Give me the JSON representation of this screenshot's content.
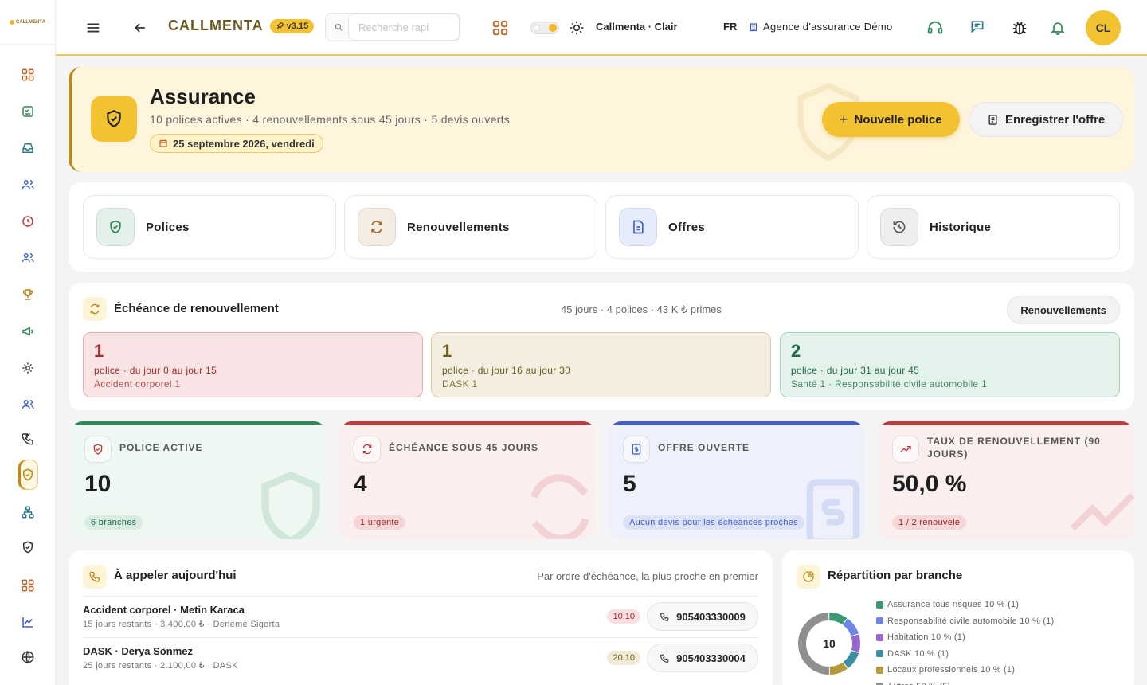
{
  "sidebar": {
    "logo": "CALLMENTA",
    "items": [
      {
        "icon": "dashboard-grid-icon"
      },
      {
        "icon": "checklist-icon"
      },
      {
        "icon": "inbox-icon"
      },
      {
        "icon": "users-icon"
      },
      {
        "icon": "clock-icon"
      },
      {
        "icon": "team-icon"
      },
      {
        "icon": "trophy-icon"
      },
      {
        "icon": "megaphone-icon"
      },
      {
        "icon": "gear-cycle-icon"
      },
      {
        "icon": "contacts-icon"
      },
      {
        "icon": "incoming-call-icon"
      },
      {
        "icon": "shield-icon",
        "active": true
      },
      {
        "icon": "org-chart-icon"
      },
      {
        "icon": "shield-check-icon"
      },
      {
        "icon": "apps-grid-icon"
      },
      {
        "icon": "line-chart-icon"
      },
      {
        "icon": "globe-icon"
      }
    ]
  },
  "topbar": {
    "brand": "CALLMENTA",
    "version": "v3.15",
    "search_placeholder": "Recherche rapi",
    "theme_label": "Callmenta · Clair",
    "language": "FR",
    "agency": "Agence d'assurance Démo",
    "avatar": "CL"
  },
  "hero": {
    "title": "Assurance",
    "subtitle": "10 polices actives · 4 renouvellements sous 45 jours · 5 devis ouverts",
    "date": "25 septembre 2026, vendredi",
    "primary_button": "Nouvelle police",
    "secondary_button": "Enregistrer l'offre"
  },
  "tiles": [
    {
      "label": "Polices",
      "icon": "shield-check-icon",
      "color": "#e3f1ea"
    },
    {
      "label": "Renouvellements",
      "icon": "refresh-icon",
      "color": "#f4ece2"
    },
    {
      "label": "Offres",
      "icon": "document-icon",
      "color": "#e6ecfb"
    },
    {
      "label": "Historique",
      "icon": "history-icon",
      "color": "#eceeef"
    }
  ],
  "renewal": {
    "title": "Échéance de renouvellement",
    "meta": "45 jours · 4 polices · 43 K ₺ primes",
    "button": "Renouvellements",
    "buckets": [
      {
        "count": "1",
        "line1": "police · du jour 0 au jour 15",
        "line2": "Accident corporel 1"
      },
      {
        "count": "1",
        "line1": "police · du jour 16 au jour 30",
        "line2": "DASK 1"
      },
      {
        "count": "2",
        "line1": "police · du jour 31 au jour 45",
        "line2": "Santé 1 · Responsabilité civile automobile 1"
      }
    ]
  },
  "kpis": [
    {
      "label": "POLICE ACTIVE",
      "value": "10",
      "pill": "6 branches",
      "accent": "#2e8b57"
    },
    {
      "label": "ÉCHÉANCE SOUS 45 JOURS",
      "value": "4",
      "pill": "1 urgente",
      "accent": "#c0393b"
    },
    {
      "label": "OFFRE OUVERTE",
      "value": "5",
      "pill": "Aucun devis pour les échéances proches",
      "accent": "#3f5fd1"
    },
    {
      "label_line1": "TAUX DE RENOUVELLEMENT (90",
      "label_line2": "JOURS)",
      "value": "50,0 %",
      "pill": "1 / 2 renouvelé",
      "accent": "#c0393b"
    }
  ],
  "calls": {
    "title": "À appeler aujourd'hui",
    "meta": "Par ordre d'échéance, la plus proche en premier",
    "rows": [
      {
        "title": "Accident corporel · Metin Karaca",
        "sub": "15 jours restants · 3.400,00 ₺ · Deneme Sigorta",
        "badge": "10.10",
        "phone": "905403330009"
      },
      {
        "title": "DASK · Derya Sönmez",
        "sub": "25 jours restants · 2.100,00 ₺ · DASK",
        "badge": "20.10",
        "phone": "905403330004"
      }
    ]
  },
  "distribution": {
    "title": "Répartition par branche",
    "total": "10",
    "items": [
      {
        "label": "Assurance tous risques 10 % (1)",
        "color": "#3b9a74",
        "pct": 10
      },
      {
        "label": "Responsabilité civile automobile 10 % (1)",
        "color": "#6b86e6",
        "pct": 10
      },
      {
        "label": "Habitation 10 % (1)",
        "color": "#9a66d4",
        "pct": 10
      },
      {
        "label": "DASK 10 % (1)",
        "color": "#3b8fa0",
        "pct": 10
      },
      {
        "label": "Locaux professionnels 10 % (1)",
        "color": "#b59a3c",
        "pct": 10
      },
      {
        "label": "Autres 50 % (5)",
        "color": "#8f8f8f",
        "pct": 50
      }
    ]
  }
}
